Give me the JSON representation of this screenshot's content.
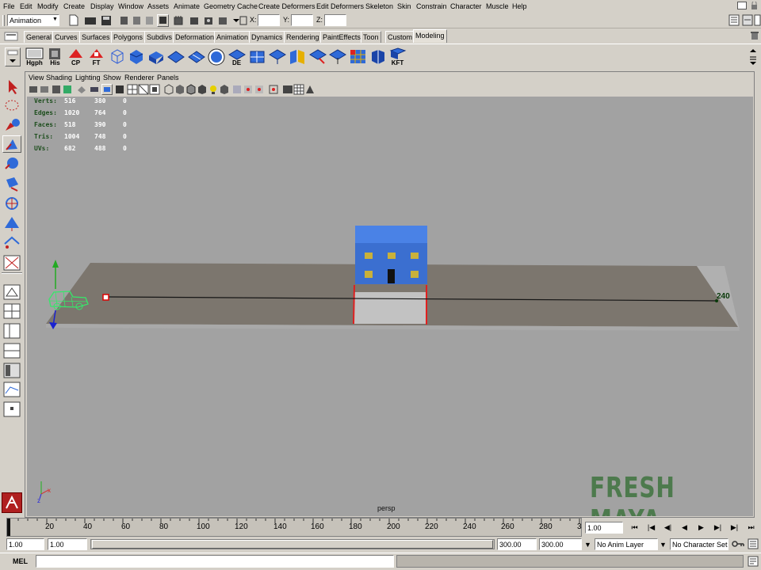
{
  "menu": [
    "File",
    "Edit",
    "Modify",
    "Create",
    "Display",
    "Window",
    "Assets",
    "Animate",
    "Geometry Cache",
    "Create Deformers",
    "Edit Deformers",
    "Skeleton",
    "Skin",
    "Constrain",
    "Character",
    "Muscle",
    "Help"
  ],
  "status": {
    "menu_set": "Animation",
    "x_label": "X:",
    "y_label": "Y:",
    "z_label": "Z:"
  },
  "shelf_tabs": [
    "General",
    "Curves",
    "Surfaces",
    "Polygons",
    "Subdivs",
    "Deformation",
    "Animation",
    "Dynamics",
    "Rendering",
    "PaintEffects",
    "Toon",
    "Custom",
    "Modeling"
  ],
  "active_shelf_tab": "Modeling",
  "shelf_labels": {
    "hgph": "Hgph",
    "his": "His",
    "cp": "CP",
    "ft": "FT",
    "de": "DE",
    "kft": "KFT"
  },
  "panel_menu": [
    "View",
    "Shading",
    "Lighting",
    "Show",
    "Renderer",
    "Panels"
  ],
  "hud": {
    "rows": [
      {
        "label": "Verts:",
        "a": "516",
        "b": "380",
        "c": "0"
      },
      {
        "label": "Edges:",
        "a": "1020",
        "b": "764",
        "c": "0"
      },
      {
        "label": "Faces:",
        "a": "518",
        "b": "390",
        "c": "0"
      },
      {
        "label": "Tris:",
        "a": "1004",
        "b": "748",
        "c": "0"
      },
      {
        "label": "UVs:",
        "a": "682",
        "b": "488",
        "c": "0"
      }
    ],
    "camera": "persp",
    "path_end_frame": "240",
    "watermark": "FRESH MAYA",
    "axis_x": "x",
    "axis_z": "z"
  },
  "timeline": {
    "ticks": [
      "20",
      "40",
      "60",
      "80",
      "100",
      "120",
      "140",
      "160",
      "180",
      "200",
      "220",
      "240",
      "260",
      "280",
      "3"
    ],
    "current_frame": "1.00",
    "start_frame": "1.00",
    "range_start": "1.00",
    "range_end": "300.00",
    "end_frame": "300.00",
    "anim_layer": "No Anim Layer",
    "character_set": "No Character Set"
  },
  "cmd": {
    "label": "MEL"
  },
  "colors": {
    "viewport_bg": "#a2a2a2",
    "ground": "#7c766e",
    "house": "#3b6fd0",
    "wireframe": "#36e86a"
  }
}
